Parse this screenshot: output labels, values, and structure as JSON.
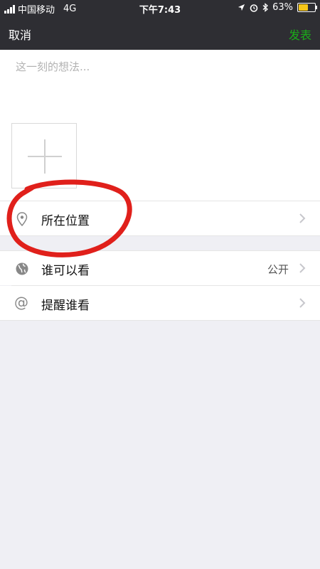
{
  "status_bar": {
    "carrier": "中国移动",
    "network": "4G",
    "time": "下午7:43",
    "battery_percent": "63%",
    "battery_level": 0.63
  },
  "nav": {
    "cancel_label": "取消",
    "publish_label": "发表",
    "publish_color": "#1aad19"
  },
  "compose": {
    "placeholder": "这一刻的想法...",
    "add_icon": "plus-icon"
  },
  "options": {
    "location": {
      "label": "所在位置",
      "icon": "location-pin-icon"
    },
    "visibility": {
      "label": "谁可以看",
      "value": "公开",
      "icon": "globe-icon"
    },
    "mention": {
      "label": "提醒谁看",
      "icon": "at-icon"
    }
  },
  "annotation_color": "#e0201b"
}
